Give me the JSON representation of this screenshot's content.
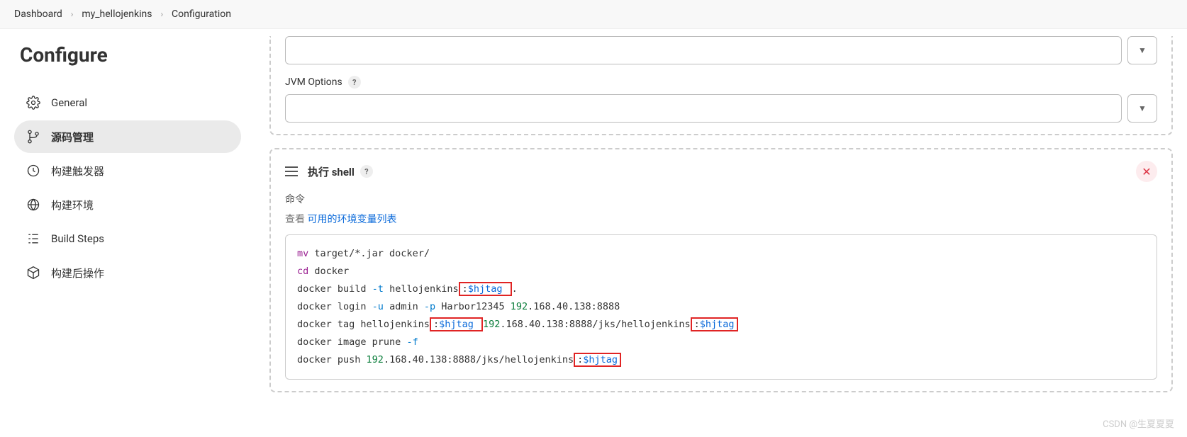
{
  "breadcrumb": {
    "items": [
      "Dashboard",
      "my_hellojenkins",
      "Configuration"
    ]
  },
  "page": {
    "title": "Configure"
  },
  "sidebar": {
    "items": [
      {
        "label": "General",
        "icon": "gear-icon"
      },
      {
        "label": "源码管理",
        "icon": "branch-icon"
      },
      {
        "label": "构建触发器",
        "icon": "clock-icon"
      },
      {
        "label": "构建环境",
        "icon": "globe-icon"
      },
      {
        "label": "Build Steps",
        "icon": "steps-icon"
      },
      {
        "label": "构建后操作",
        "icon": "cube-icon"
      }
    ]
  },
  "form": {
    "jvm_options_label": "JVM Options",
    "input1_value": "",
    "input2_value": ""
  },
  "shell": {
    "title": "执行 shell",
    "cmd_label": "命令",
    "link_prefix": "查看 ",
    "link_text": "可用的环境变量列表",
    "code": {
      "l1_cmd": "mv",
      "l1_rest": " target/*.jar docker/",
      "l2_cmd": "cd",
      "l2_rest": " docker",
      "l3_p1": "docker build ",
      "l3_flag": "-t",
      "l3_p2": " hellojenkins",
      "l3_hl1_colon": ":",
      "l3_hl1_var": "$hjtag",
      "l3_hl1_sp": " ",
      "l3_p3": ".",
      "l4_p1": "docker login ",
      "l4_flag1": "-u",
      "l4_p2": " admin ",
      "l4_flag2": "-p",
      "l4_p3": " Harbor12345 ",
      "l4_ip": "192",
      "l4_p4": ".168.40.138:8888",
      "l5_p1": "docker tag hellojenkins",
      "l5_hl1_colon": ":",
      "l5_hl1_var": "$hjtag",
      "l5_hl1_sp": " ",
      "l5_ip": "192",
      "l5_p2": ".168.40.138:8888/jks/hellojenkins",
      "l5_hl2_colon": ":",
      "l5_hl2_var": "$hjtag",
      "l6_p1": "docker image prune ",
      "l6_flag": "-f",
      "l7_p1": "docker push ",
      "l7_ip": "192",
      "l7_p2": ".168.40.138:8888/jks/hellojenkins",
      "l7_hl_colon": ":",
      "l7_hl_var": "$hjtag"
    }
  },
  "watermark": "CSDN @生夏夏夏"
}
